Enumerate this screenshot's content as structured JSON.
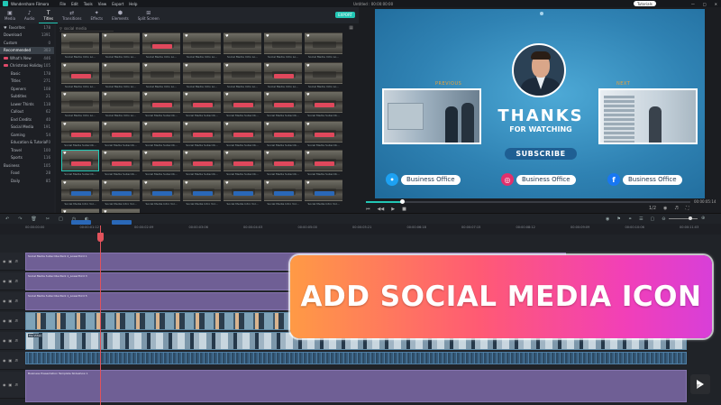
{
  "titlebar": {
    "app_name": "Wondershare Filmora",
    "menu": [
      "File",
      "Edit",
      "Tools",
      "View",
      "Export",
      "Help"
    ],
    "doc_title": "Untitled : 00:00:00:00",
    "tutorial": "Tutorials",
    "window_buttons": [
      "—",
      "□",
      "✕"
    ]
  },
  "lib_tabs": [
    {
      "label": "Media",
      "glyph": "▣"
    },
    {
      "label": "Audio",
      "glyph": "♪"
    },
    {
      "label": "Titles",
      "glyph": "T"
    },
    {
      "label": "Transitions",
      "glyph": "⇄"
    },
    {
      "label": "Effects",
      "glyph": "✦"
    },
    {
      "label": "Elements",
      "glyph": "⬢"
    },
    {
      "label": "Split Screen",
      "glyph": "⊞"
    }
  ],
  "export_label": "EXPORT",
  "sidebar": [
    {
      "label": "Favorites",
      "count": "178"
    },
    {
      "label": "Download",
      "count": "1391"
    },
    {
      "label": "Custom",
      "count": "0"
    },
    {
      "label": "Recommended",
      "count": "303"
    },
    {
      "label": "What's New",
      "count": "446"
    },
    {
      "label": "Christmas Holiday",
      "count": "105"
    },
    {
      "label": "Basic",
      "count": "178"
    },
    {
      "label": "Titles",
      "count": "271"
    },
    {
      "label": "Openers",
      "count": "108"
    },
    {
      "label": "Subtitles",
      "count": "21"
    },
    {
      "label": "Lower Thirds",
      "count": "118"
    },
    {
      "label": "Callout",
      "count": "62"
    },
    {
      "label": "End Credits",
      "count": "40"
    },
    {
      "label": "Social Media",
      "count": "191"
    },
    {
      "label": "Gaming",
      "count": "54"
    },
    {
      "label": "Education & Tutorial",
      "count": "70"
    },
    {
      "label": "Travel",
      "count": "100"
    },
    {
      "label": "Sports",
      "count": "116"
    },
    {
      "label": "Business",
      "count": "105"
    },
    {
      "label": "Food",
      "count": "28"
    },
    {
      "label": "Daily",
      "count": "85"
    }
  ],
  "search_value": "social media",
  "thumb_labels": {
    "intro": "Social Media Intro Lo...",
    "subscribe": "Social Media Subscrib...",
    "intro_vol": "Social Media Intro Vol..."
  },
  "preview": {
    "previous": "PREVIOUS",
    "next": "NEXT",
    "thanks": "THANKS",
    "watching": "FOR WATCHING",
    "subscribe": "SUBSCRIBE",
    "social": [
      {
        "name": "Business Office",
        "icon": "twitter-icon",
        "color": "#1da1f2",
        "glyph": "•"
      },
      {
        "name": "Business Office",
        "icon": "instagram-icon",
        "color": "#e1306c",
        "glyph": "◎"
      },
      {
        "name": "Business Office",
        "icon": "facebook-icon",
        "color": "#1877f2",
        "glyph": "f"
      }
    ],
    "timecode": "00:00:05:14",
    "progress": 0.11,
    "ratio": "1/2"
  },
  "ruler_ticks": [
    "00:00:00:00",
    "00:00:01:12",
    "00:00:02:09",
    "00:00:03:06",
    "00:00:04:03",
    "00:00:05:00",
    "00:00:05:21",
    "00:00:06:18",
    "00:00:07:15",
    "00:00:08:12",
    "00:00:09:09",
    "00:00:10:06",
    "00:00:11:03"
  ],
  "clips": {
    "track1": "Social Media Subscribe Pack 2_Lowerthird 1",
    "track2": "Social Media Subscribe Pack 1_Lowerthird 3",
    "track3": "Social Media Subscribe Pack 1_Lowerthird 5",
    "video_name": "file Video",
    "bottom": "Business Presentation Template Slideshow 1"
  },
  "banner": "ADD SOCIAL MEDIA ICON",
  "colors": {
    "accent": "#22c7b5",
    "playhead": "#e2535c",
    "clip": "#6f5f95"
  }
}
